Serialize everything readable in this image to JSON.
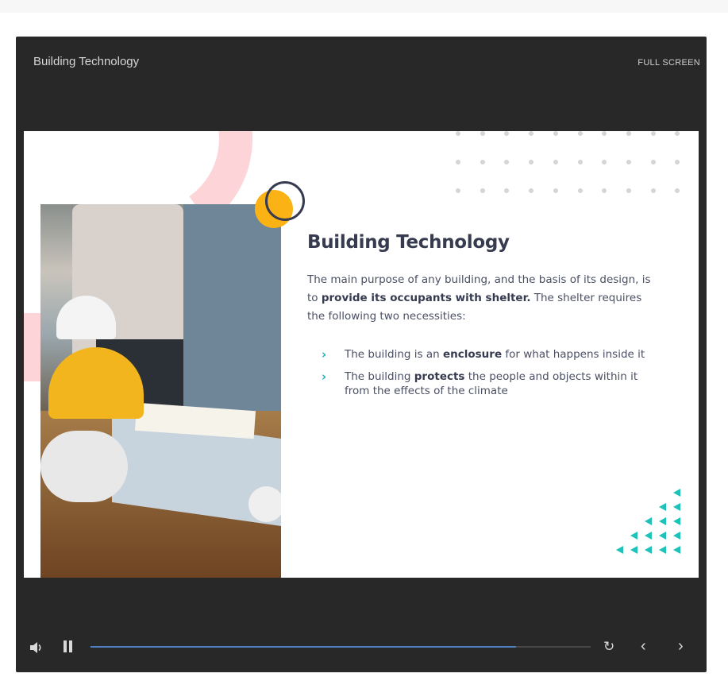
{
  "player": {
    "title": "Building Technology",
    "fullscreen_label": "FULL SCREEN"
  },
  "slide": {
    "title": "Building Technology",
    "body_part1": "The main purpose of any building, and the basis of its design, is to ",
    "body_bold": "provide its occupants with shelter.",
    "body_part2": " The shelter requires the following two necessities:",
    "bullets": [
      {
        "pre": "The building is an ",
        "bold": "enclosure",
        "post": " for what happens inside it"
      },
      {
        "pre": "The building ",
        "bold": "protects",
        "post": " the people and objects within it from the effects of the climate"
      }
    ],
    "bullet_marker": "›"
  },
  "controls": {
    "volume_icon": "speaker-icon",
    "pause_icon": "pause-icon",
    "replay_icon": "replay-icon",
    "prev_icon": "chevron-left-icon",
    "next_icon": "chevron-right-icon",
    "progress_fraction": 0.85,
    "prev_glyph": "‹",
    "next_glyph": "›",
    "replay_glyph": "↻"
  },
  "colors": {
    "player_bg": "#282828",
    "accent_teal": "#1bb0bf",
    "accent_yellow": "#fbb214",
    "accent_pink": "#fdd4d8",
    "title_navy": "#363b50",
    "progress_blue": "#4f80c2"
  }
}
